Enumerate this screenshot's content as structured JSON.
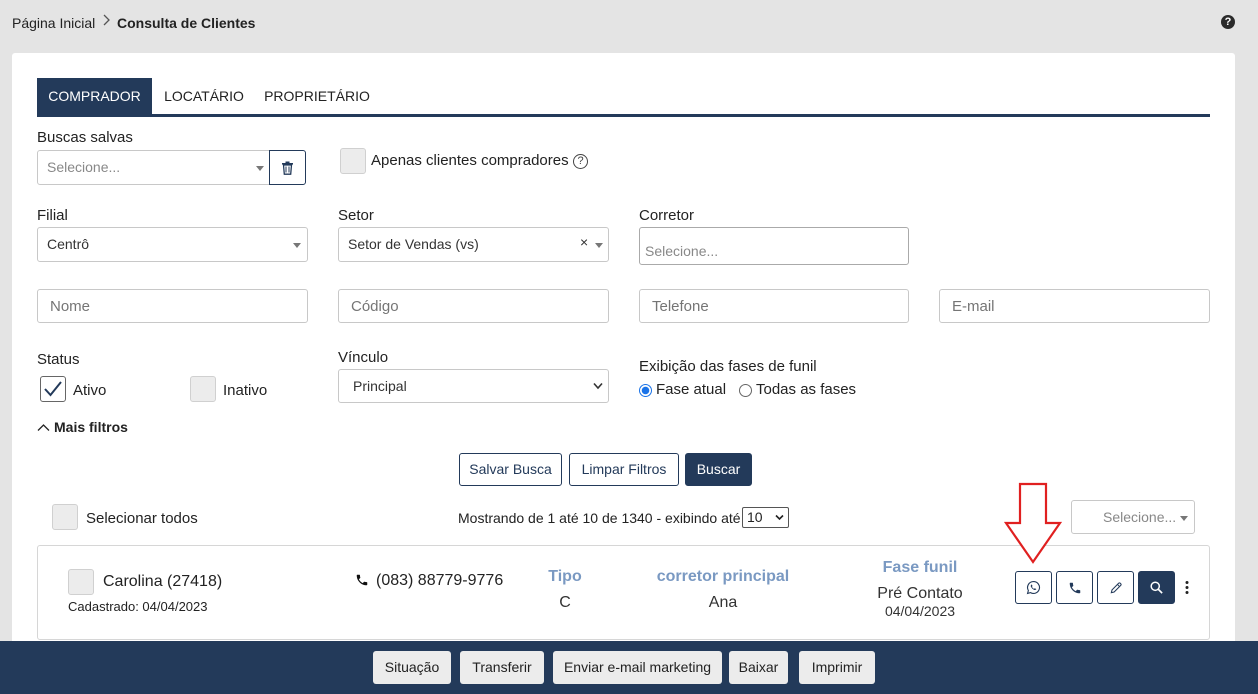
{
  "breadcrumb": {
    "home": "Página Inicial",
    "current": "Consulta de Clientes"
  },
  "help_glyph": "?",
  "tabs": [
    {
      "label": "COMPRADOR",
      "active": true
    },
    {
      "label": "LOCATÁRIO",
      "active": false
    },
    {
      "label": "PROPRIETÁRIO",
      "active": false
    }
  ],
  "saved_searches": {
    "label": "Buscas salvas",
    "placeholder": "Selecione..."
  },
  "only_buyers": {
    "label": "Apenas clientes compradores",
    "checked": false
  },
  "filial": {
    "label": "Filial",
    "value": "Centrô"
  },
  "setor": {
    "label": "Setor",
    "value": "Setor de Vendas (vs)",
    "clear": "×"
  },
  "corretor": {
    "label": "Corretor",
    "placeholder": "Selecione..."
  },
  "inputs": {
    "nome": "Nome",
    "codigo": "Código",
    "telefone": "Telefone",
    "email": "E-mail"
  },
  "status": {
    "label": "Status",
    "ativo": "Ativo",
    "ativo_checked": true,
    "inativo": "Inativo",
    "inativo_checked": false
  },
  "vinculo": {
    "label": "Vínculo",
    "value": "Principal"
  },
  "funil": {
    "label": "Exibição das fases de funil",
    "option1": "Fase atual",
    "option2": "Todas as fases",
    "selected": "Fase atual"
  },
  "mais_filtros": "Mais filtros",
  "actions": {
    "save": "Salvar Busca",
    "clear": "Limpar Filtros",
    "search": "Buscar"
  },
  "select_all": "Selecionar todos",
  "pagination": {
    "text": "Mostrando de 1 até 10 de 1340 - exibindo até",
    "per_page": "10"
  },
  "bulk_select": {
    "placeholder": "Selecione..."
  },
  "client": {
    "name": "Carolina (27418)",
    "registered": "Cadastrado: 04/04/2023",
    "phone": "(083) 88779-9776",
    "tipo_label": "Tipo",
    "tipo_value": "C",
    "corretor_label": "corretor principal",
    "corretor_value": "Ana",
    "fase_label": "Fase funil",
    "fase_value": "Pré Contato",
    "fase_date": "04/04/2023"
  },
  "footer_buttons": [
    "Situação",
    "Transferir",
    "Enviar e-mail marketing",
    "Baixar",
    "Imprimir"
  ],
  "colors": {
    "primary": "#233a5a",
    "accent_text": "#7a99c2",
    "annotation_arrow": "#e02020"
  }
}
